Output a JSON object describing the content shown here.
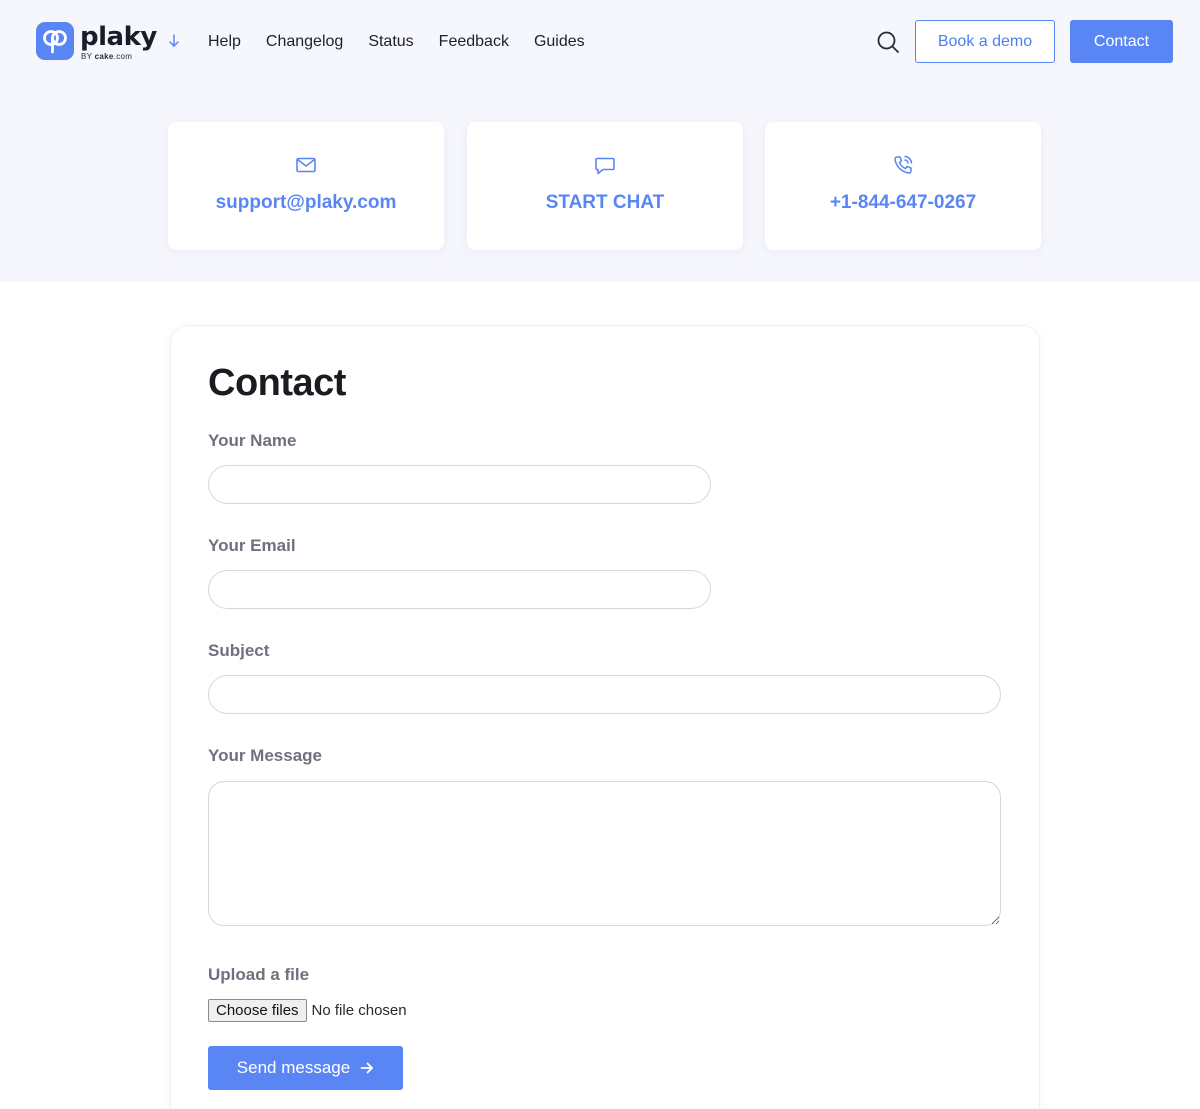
{
  "brand": {
    "name": "plaky",
    "sub_prefix": "BY",
    "sub_brand": "cake",
    "sub_suffix": ".com",
    "accent_color": "#5a86f5"
  },
  "nav": {
    "items": [
      {
        "label": "Help"
      },
      {
        "label": "Changelog"
      },
      {
        "label": "Status"
      },
      {
        "label": "Feedback"
      },
      {
        "label": "Guides"
      }
    ],
    "book_demo_label": "Book a demo",
    "contact_label": "Contact"
  },
  "cards": [
    {
      "icon": "mail-icon",
      "label": "support@plaky.com"
    },
    {
      "icon": "chat-bubble-icon",
      "label": "START CHAT"
    },
    {
      "icon": "phone-call-icon",
      "label": "+1-844-647-0267"
    }
  ],
  "form": {
    "title": "Contact",
    "name_label": "Your Name",
    "name_value": "",
    "email_label": "Your Email",
    "email_value": "",
    "subject_label": "Subject",
    "subject_value": "",
    "message_label": "Your Message",
    "message_value": "",
    "upload_label": "Upload a file",
    "choose_files_label": "Choose files",
    "no_file_text": "No file chosen",
    "send_label": "Send message"
  }
}
